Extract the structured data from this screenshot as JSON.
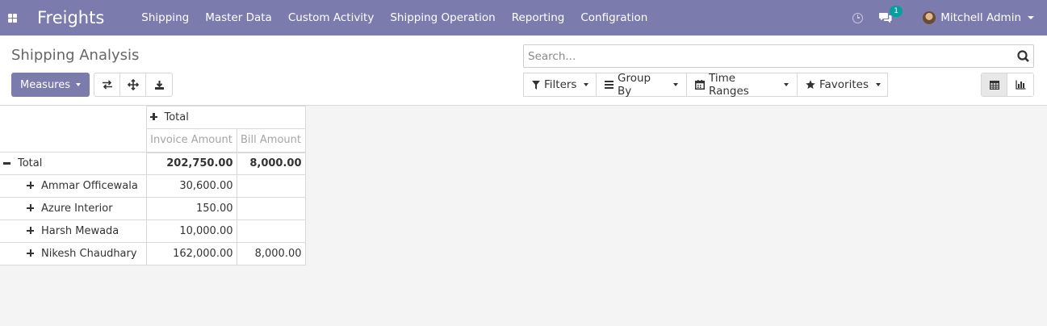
{
  "navbar": {
    "brand": "Freights",
    "menu": [
      "Shipping",
      "Master Data",
      "Custom Activity",
      "Shipping Operation",
      "Reporting",
      "Configration"
    ],
    "chat_badge": "1",
    "user_name": "Mitchell Admin",
    "background_color": "#7c7bad"
  },
  "control_panel": {
    "title": "Shipping Analysis",
    "measures_label": "Measures",
    "search_placeholder": "Search...",
    "filters": {
      "filters_label": "Filters",
      "group_by_label": "Group By",
      "time_ranges_label": "Time Ranges",
      "favorites_label": "Favorites"
    },
    "icons": {
      "flip": "swap-arrows-icon",
      "expand": "expand-arrows-icon",
      "download": "download-icon",
      "pivot_view": "table-icon",
      "graph_view": "bar-chart-icon"
    }
  },
  "pivot": {
    "column_header": "Total",
    "measures": [
      "Invoice Amount",
      "Bill Amount"
    ],
    "total_row": {
      "label": "Total",
      "invoice": "202,750.00",
      "bill": "8,000.00"
    },
    "rows": [
      {
        "label": "Ammar Officewala",
        "invoice": "30,600.00",
        "bill": ""
      },
      {
        "label": "Azure Interior",
        "invoice": "150.00",
        "bill": ""
      },
      {
        "label": "Harsh Mewada",
        "invoice": "10,000.00",
        "bill": ""
      },
      {
        "label": "Nikesh Chaudhary",
        "invoice": "162,000.00",
        "bill": "8,000.00"
      }
    ]
  }
}
